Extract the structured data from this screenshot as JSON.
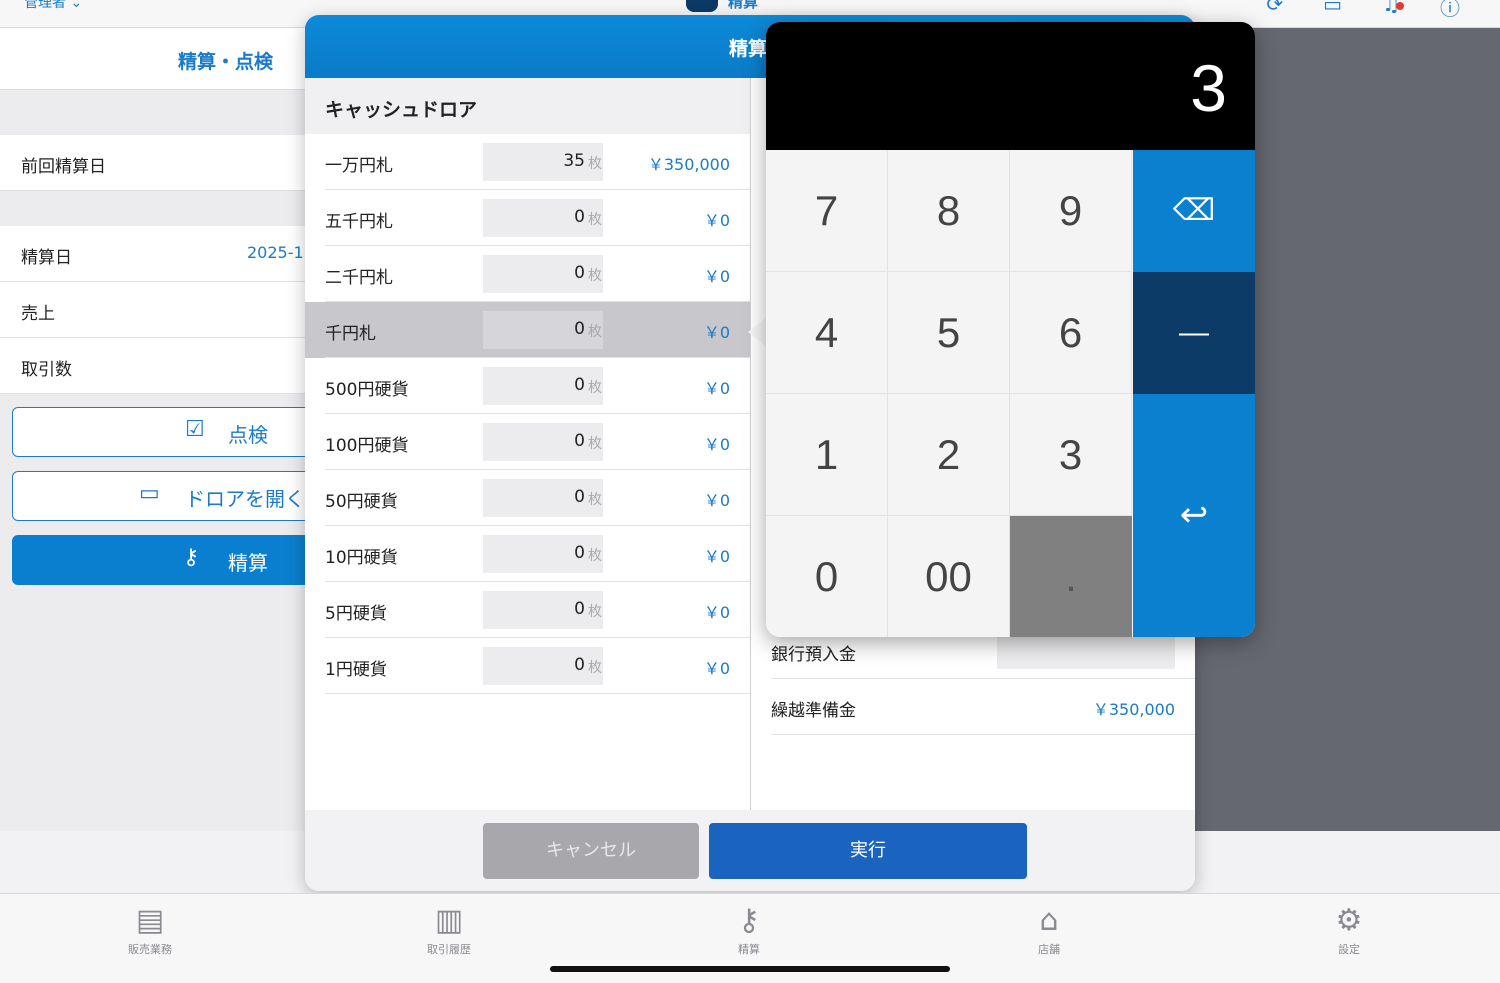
{
  "topbar": {
    "user": "管理者 ⌄",
    "title": "精算",
    "icons": [
      "refresh-icon",
      "window-icon",
      "bell-icon",
      "info-icon"
    ]
  },
  "left": {
    "title": "精算・点検",
    "prev_label": "前回精算日",
    "date_label": "精算日",
    "date_value": "2025-1",
    "sales_label": "売上",
    "transactions_label": "取引数",
    "inspect_button": "点検",
    "open_drawer_button": "ドロアを開く",
    "settle_button": "精算"
  },
  "modal": {
    "title": "精算",
    "drawer_title": "キャッシュドロア",
    "unit": "枚",
    "rows": [
      {
        "name": "一万円札",
        "count": "35",
        "amount": "￥350,000"
      },
      {
        "name": "五千円札",
        "count": "0",
        "amount": "￥0"
      },
      {
        "name": "二千円札",
        "count": "0",
        "amount": "￥0"
      },
      {
        "name": "千円札",
        "count": "0",
        "amount": "￥0"
      },
      {
        "name": "500円硬貨",
        "count": "0",
        "amount": "￥0"
      },
      {
        "name": "100円硬貨",
        "count": "0",
        "amount": "￥0"
      },
      {
        "name": "50円硬貨",
        "count": "0",
        "amount": "￥0"
      },
      {
        "name": "10円硬貨",
        "count": "0",
        "amount": "￥0"
      },
      {
        "name": "5円硬貨",
        "count": "0",
        "amount": "￥0"
      },
      {
        "name": "1円硬貨",
        "count": "0",
        "amount": "￥0"
      }
    ],
    "bank_deposit_label": "銀行預入金",
    "carryover_label": "繰越準備金",
    "carryover_value": "￥350,000",
    "cancel_button": "キャンセル",
    "execute_button": "実行"
  },
  "keypad": {
    "display": "3",
    "keys": [
      "7",
      "8",
      "9",
      "4",
      "5",
      "6",
      "1",
      "2",
      "3",
      "0",
      "00",
      "."
    ],
    "backspace_icon": "⌫",
    "minus_label": "—",
    "enter_icon": "↩"
  },
  "tabs": [
    {
      "label": "販売業務",
      "icon": "register-icon"
    },
    {
      "label": "取引履歴",
      "icon": "book-icon"
    },
    {
      "label": "精算",
      "icon": "key-icon"
    },
    {
      "label": "店舗",
      "icon": "home-icon"
    },
    {
      "label": "設定",
      "icon": "gear-icon"
    }
  ],
  "colors": {
    "accent": "#0a7fcf",
    "navy": "#0b3b66",
    "execute": "#1a64c0",
    "cancel": "#a8a8ac"
  }
}
